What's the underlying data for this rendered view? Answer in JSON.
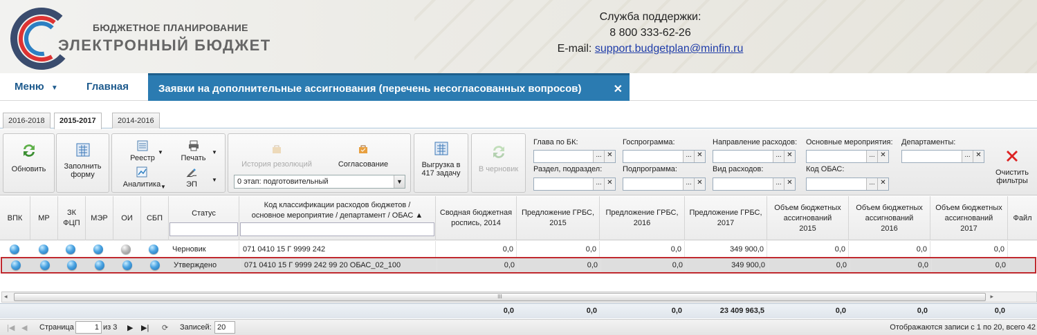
{
  "header": {
    "brand_top": "БЮДЖЕТНОЕ ПЛАНИРОВАНИЕ",
    "brand_bottom": "ЭЛЕКТРОННЫЙ БЮДЖЕТ",
    "support_title": "Служба поддержки:",
    "support_phone": "8 800 333-62-26",
    "support_email_label": "E-mail:",
    "support_email": "support.budgetplan@minfin.ru"
  },
  "nav": {
    "menu": "Меню",
    "home": "Главная",
    "active_tab": "Заявки на дополнительные ассигнования (перечень несогласованных вопросов)",
    "close": "✕"
  },
  "year_tabs": [
    "2016-2018",
    "2015-2017",
    "2014-2016"
  ],
  "toolbar": {
    "refresh": "Обновить",
    "fill_form_1": "Заполнить",
    "fill_form_2": "форму",
    "registry": "Реестр",
    "print": "Печать",
    "analytics": "Аналитика",
    "ep": "ЭП",
    "history": "История резолюций",
    "approval": "Согласование",
    "stage_value": "0 этап: подготовительный",
    "export_1": "Выгрузка в",
    "export_2": "417 задачу",
    "to_draft": "В черновик",
    "clear_1": "Очистить",
    "clear_2": "фильтры"
  },
  "filters": {
    "head_bk": "Глава по БК:",
    "gosprog": "Госпрограмма:",
    "direction": "Направление расходов:",
    "main_events": "Основные мероприятия:",
    "departments": "Департаменты:",
    "section": "Раздел, подраздел:",
    "subprog": "Подпрограмма:",
    "expense_type": "Вид расходов:",
    "obas_code": "Код ОБАС:",
    "dots": "...",
    "x": "✕"
  },
  "grid": {
    "columns": {
      "vpk": "ВПК",
      "mr": "МР",
      "zk_1": "ЗК",
      "zk_2": "ФЦП",
      "mer": "МЭР",
      "oi": "ОИ",
      "sbp": "СБП",
      "status": "Статус",
      "code_1": "Код классификации расходов бюджетов /",
      "code_2": "основное мероприятие / департамент / ОБАС ▲",
      "svod_1": "Сводная бюджетная",
      "svod_2": "роспись, 2014",
      "grbs15_1": "Предложение ГРБС,",
      "grbs15_2": "2015",
      "grbs16_1": "Предложение ГРБС,",
      "grbs16_2": "2016",
      "grbs17_1": "Предложение ГРБС,",
      "grbs17_2": "2017",
      "vol15_1": "Объем бюджетных",
      "vol15_2": "ассигнований",
      "vol15_3": "2015",
      "vol16_1": "Объем бюджетных",
      "vol16_2": "ассигнований",
      "vol16_3": "2016",
      "vol17_1": "Объем бюджетных",
      "vol17_2": "ассигнований",
      "vol17_3": "2017",
      "file": "Файл"
    },
    "rows": [
      {
        "status": "Черновик",
        "code": "071 0410 15 Г 9999 242",
        "svod": "0,0",
        "grbs15": "0,0",
        "grbs16": "0,0",
        "grbs17": "349 900,0",
        "vol15": "0,0",
        "vol16": "0,0",
        "vol17": "0,0",
        "oi_gray": true
      },
      {
        "status": "Утверждено",
        "code": "071 0410 15 Г 9999 242 99 20 ОБАС_02_100",
        "svod": "0,0",
        "grbs15": "0,0",
        "grbs16": "0,0",
        "grbs17": "349 900,0",
        "vol15": "0,0",
        "vol16": "0,0",
        "vol17": "0,0",
        "oi_gray": false
      }
    ],
    "totals": {
      "svod": "0,0",
      "grbs15": "0,0",
      "grbs16": "0,0",
      "grbs17": "23 409 963,5",
      "vol15": "0,0",
      "vol16": "0,0",
      "vol17": "0,0"
    },
    "scroll_grip": "III"
  },
  "pager": {
    "page_label": "Страница",
    "page_value": "1",
    "of_label": "из 3",
    "records_label": "Записей:",
    "records_value": "20",
    "summary": "Отображаются записи с 1 по 20, всего 42"
  }
}
